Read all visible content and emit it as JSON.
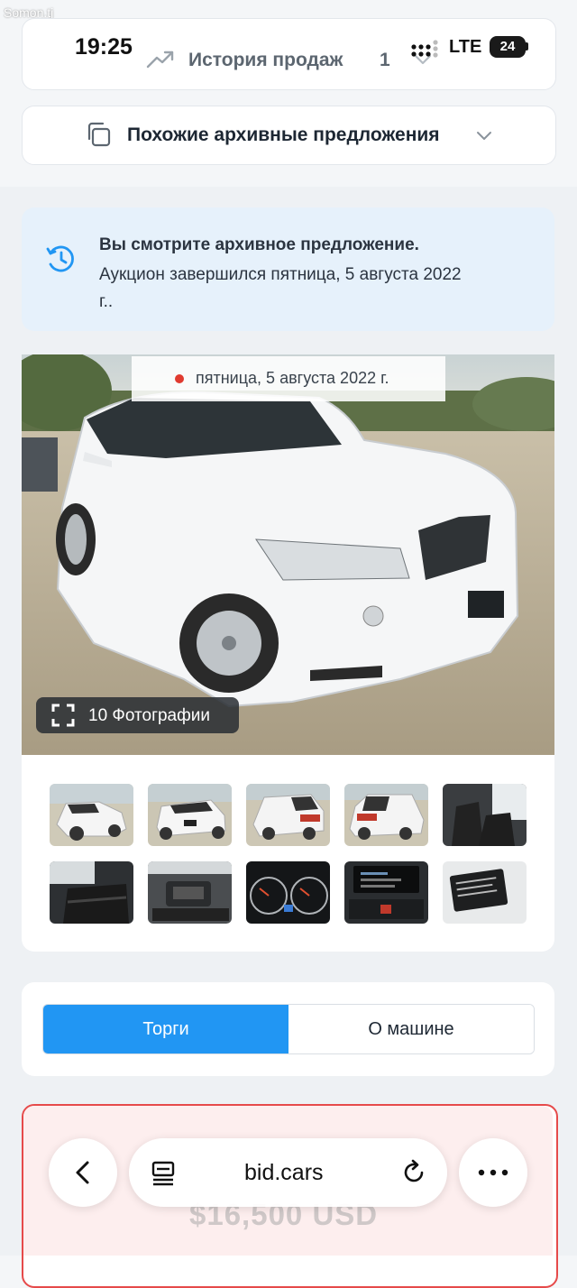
{
  "watermark": "Somon.tj",
  "status_bar": {
    "time": "19:25",
    "network": "LTE",
    "battery": "24"
  },
  "sales_history": {
    "label": "История продаж",
    "count": "1",
    "icon": "trending-up-icon"
  },
  "similar_offers": {
    "label": "Похожие архивные предложения",
    "icon": "copy-icon"
  },
  "archive_notice": {
    "title": "Вы смотрите архивное предложение.",
    "text": "Аукцион завершился пятница, 5 августа 2022 г..",
    "icon": "history-icon"
  },
  "gallery": {
    "date": "пятница, 5 августа 2022 г.",
    "photos_button": "10 Фотографии",
    "thumbnails": [
      "front-left-view",
      "front-view",
      "rear-left-view",
      "rear-right-view",
      "front-interior",
      "rear-interior",
      "engine-bay",
      "instrument-cluster",
      "infotainment-screen",
      "vin-label"
    ]
  },
  "tabs": {
    "bidding": "Торги",
    "about_car": "О машине",
    "active": "bidding"
  },
  "price": "$16,500 USD",
  "browser": {
    "url": "bid.cars"
  },
  "colors": {
    "accent": "#2196f3",
    "notice_bg": "#e6f1fb",
    "alert_border": "#e64a4a",
    "date_dot": "#e03a2f"
  }
}
